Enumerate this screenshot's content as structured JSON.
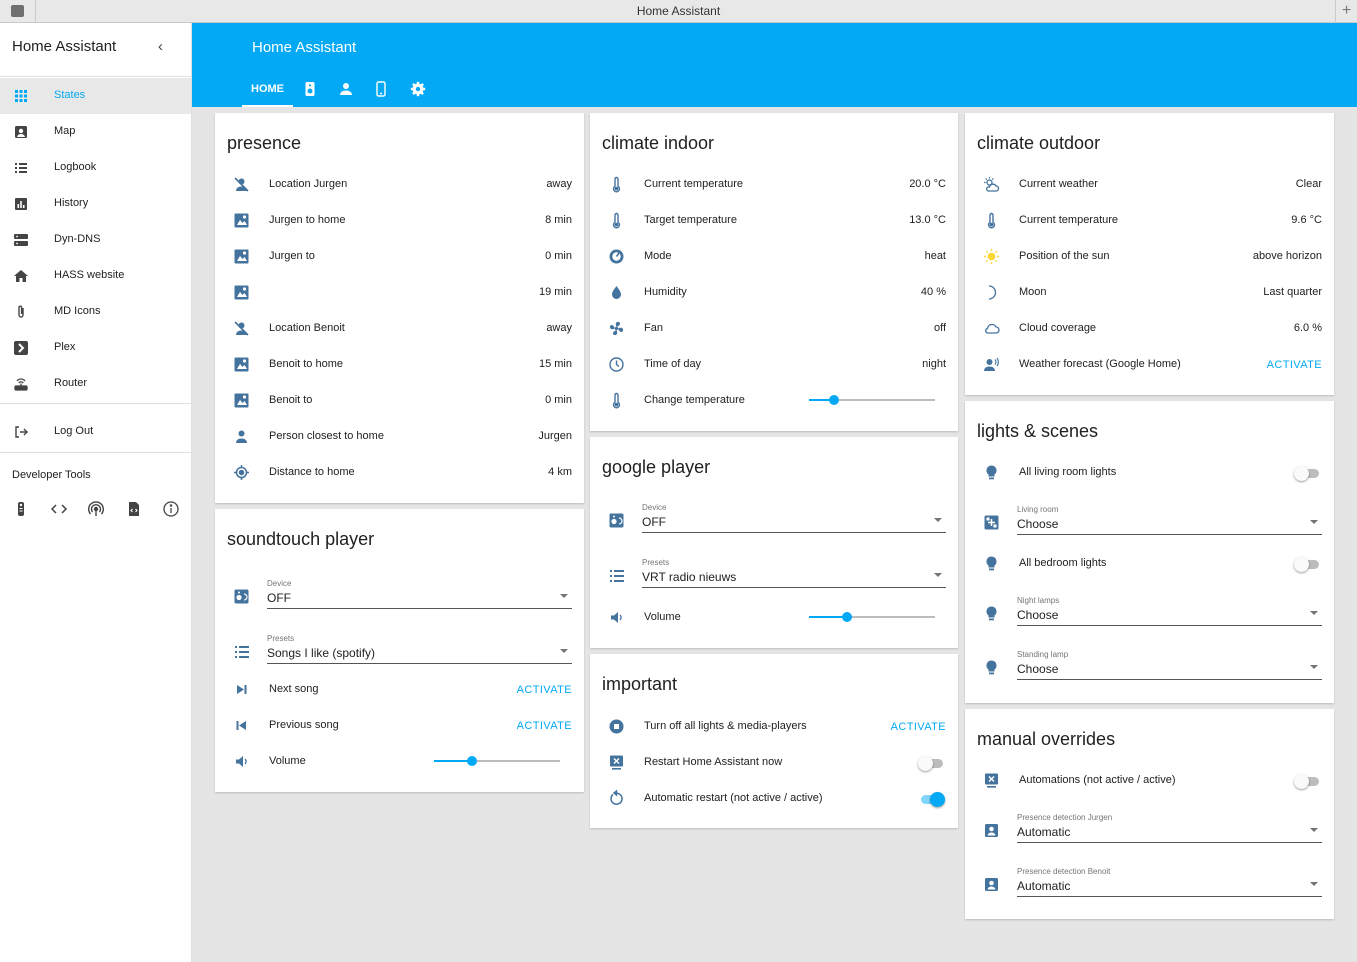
{
  "window": {
    "title": "Home Assistant"
  },
  "sidebar": {
    "title": "Home Assistant",
    "items": [
      {
        "label": "States",
        "icon": "grid-icon"
      },
      {
        "label": "Map",
        "icon": "account-box-icon"
      },
      {
        "label": "Logbook",
        "icon": "list-icon"
      },
      {
        "label": "History",
        "icon": "chart-bar-icon"
      },
      {
        "label": "Dyn-DNS",
        "icon": "server-icon"
      },
      {
        "label": "HASS website",
        "icon": "home-icon"
      },
      {
        "label": "MD Icons",
        "icon": "paperclip-icon"
      },
      {
        "label": "Plex",
        "icon": "plex-icon"
      },
      {
        "label": "Router",
        "icon": "router-wireless-icon"
      },
      {
        "label": "Log Out",
        "icon": "exit-icon"
      }
    ],
    "developer_tools": {
      "title": "Developer Tools"
    }
  },
  "header": {
    "title": "Home Assistant",
    "tabs": [
      {
        "label": "HOME"
      }
    ]
  },
  "accent": "#03a9f4",
  "cards": {
    "presence": {
      "title": "presence",
      "rows": [
        {
          "name": "Location Jurgen",
          "value": "away"
        },
        {
          "name": "Jurgen to home",
          "value": "8 min"
        },
        {
          "name": "Jurgen to",
          "value": "0 min"
        },
        {
          "name": "",
          "value": "19 min"
        },
        {
          "name": "Location Benoit",
          "value": "away"
        },
        {
          "name": "Benoit to home",
          "value": "15 min"
        },
        {
          "name": "Benoit to",
          "value": "0 min"
        },
        {
          "name": "Person closest to home",
          "value": "Jurgen"
        },
        {
          "name": "Distance to home",
          "value": "4 km"
        }
      ]
    },
    "soundtouch": {
      "title": "soundtouch player",
      "device": {
        "label": "Device",
        "value": "OFF"
      },
      "presets": {
        "label": "Presets",
        "value": "Songs I like (spotify)"
      },
      "next": {
        "name": "Next song",
        "action": "ACTIVATE"
      },
      "prev": {
        "name": "Previous song",
        "action": "ACTIVATE"
      },
      "volume": {
        "name": "Volume",
        "level": 0.3
      }
    },
    "climate_indoor": {
      "title": "climate indoor",
      "rows": [
        {
          "name": "Current temperature",
          "value": "20.0 °C"
        },
        {
          "name": "Target temperature",
          "value": "13.0 °C"
        },
        {
          "name": "Mode",
          "value": "heat"
        },
        {
          "name": "Humidity",
          "value": "40 %"
        },
        {
          "name": "Fan",
          "value": "off"
        },
        {
          "name": "Time of day",
          "value": "night"
        }
      ],
      "change": {
        "name": "Change temperature",
        "level": 0.2
      }
    },
    "google_player": {
      "title": "google player",
      "device": {
        "label": "Device",
        "value": "OFF"
      },
      "presets": {
        "label": "Presets",
        "value": "VRT radio nieuws"
      },
      "volume": {
        "name": "Volume",
        "level": 0.3
      }
    },
    "important": {
      "title": "important",
      "turn_off": {
        "name": "Turn off all lights & media-players",
        "action": "ACTIVATE"
      },
      "restart_now": {
        "name": "Restart Home Assistant now",
        "on": false
      },
      "auto_restart": {
        "name": "Automatic restart (not active / active)",
        "on": true
      }
    },
    "climate_outdoor": {
      "title": "climate outdoor",
      "rows": [
        {
          "name": "Current weather",
          "value": "Clear"
        },
        {
          "name": "Current temperature",
          "value": "9.6 °C"
        },
        {
          "name": "Position of the sun",
          "value": "above horizon"
        },
        {
          "name": "Moon",
          "value": "Last quarter"
        },
        {
          "name": "Cloud coverage",
          "value": "6.0 %"
        }
      ],
      "forecast": {
        "name": "Weather forecast (Google Home)",
        "action": "ACTIVATE"
      }
    },
    "lights": {
      "title": "lights & scenes",
      "living_lights": {
        "name": "All living room lights",
        "on": false
      },
      "living_room": {
        "label": "Living room",
        "value": "Choose"
      },
      "bedroom_lights": {
        "name": "All bedroom lights",
        "on": false
      },
      "night_lamps": {
        "label": "Night lamps",
        "value": "Choose"
      },
      "standing_lamp": {
        "label": "Standing lamp",
        "value": "Choose"
      }
    },
    "overrides": {
      "title": "manual overrides",
      "automations": {
        "name": "Automations (not active / active)",
        "on": false
      },
      "jurgen": {
        "label": "Presence detection Jurgen",
        "value": "Automatic"
      },
      "benoit": {
        "label": "Presence detection Benoit",
        "value": "Automatic"
      }
    }
  }
}
